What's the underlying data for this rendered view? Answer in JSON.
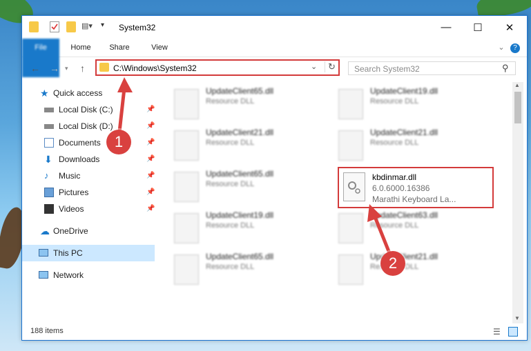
{
  "window": {
    "title": "System32"
  },
  "ribbon": {
    "file": "File",
    "home": "Home",
    "share": "Share",
    "view": "View"
  },
  "navigation": {
    "address": "C:\\Windows\\System32",
    "search_placeholder": "Search System32"
  },
  "sidebar": {
    "items": [
      {
        "label": "Quick access"
      },
      {
        "label": "Local Disk (C:)"
      },
      {
        "label": "Local Disk (D:)"
      },
      {
        "label": "Documents"
      },
      {
        "label": "Downloads"
      },
      {
        "label": "Music"
      },
      {
        "label": "Pictures"
      },
      {
        "label": "Videos"
      },
      {
        "label": "OneDrive"
      },
      {
        "label": "This PC"
      },
      {
        "label": "Network"
      }
    ]
  },
  "files": [
    {
      "name": "UpdateClient65.dll",
      "type": "Resource DLL"
    },
    {
      "name": "UpdateClient19.dll",
      "type": "Resource DLL"
    },
    {
      "name": "UpdateClient21.dll",
      "type": "Resource DLL"
    },
    {
      "name": "UpdateClient21.dll",
      "type": "Resource DLL"
    },
    {
      "name": "UpdateClient65.dll",
      "type": "Resource DLL"
    },
    {
      "name": "UpdateClient19.dll",
      "type": "Resource DLL"
    },
    {
      "name": "UpdateClient63.dll",
      "type": "Resource DLL"
    },
    {
      "name": "UpdateClient65.dll",
      "type": "Resource DLL"
    },
    {
      "name": "UpdateClient21.dll",
      "type": "Resource DLL"
    }
  ],
  "highlighted_file": {
    "name": "kbdinmar.dll",
    "version": "6.0.6000.16386",
    "description": "Marathi Keyboard La..."
  },
  "status": {
    "items": "188 items"
  },
  "annotations": {
    "step1": "1",
    "step2": "2"
  }
}
